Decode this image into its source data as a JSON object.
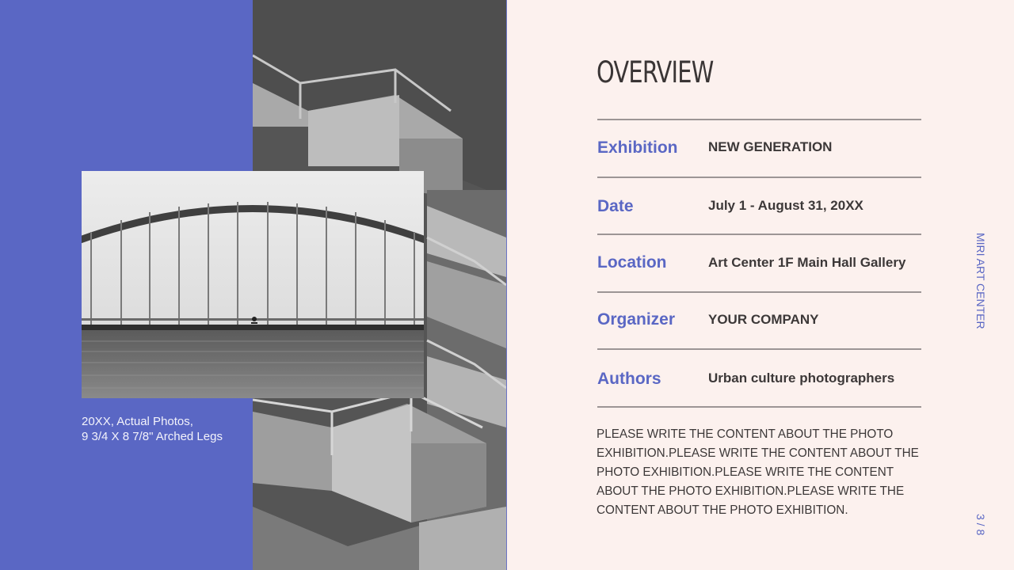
{
  "caption": {
    "line1": "20XX, Actual Photos,",
    "line2": "9 3/4 X 8 7/8\" Arched Legs"
  },
  "title": "OVERVIEW",
  "details": [
    {
      "label": "Exhibition",
      "value": "NEW GENERATION"
    },
    {
      "label": "Date",
      "value": "July 1 - August 31, 20XX"
    },
    {
      "label": "Location",
      "value": "Art Center 1F Main Hall Gallery"
    },
    {
      "label": "Organizer",
      "value": "YOUR COMPANY"
    },
    {
      "label": "Authors",
      "value": "Urban culture photographers"
    }
  ],
  "description": "PLEASE WRITE THE CONTENT ABOUT THE PHOTO EXHIBITION.PLEASE WRITE THE CONTENT ABOUT THE PHOTO EXHIBITION.PLEASE WRITE THE CONTENT ABOUT THE PHOTO EXHIBITION.PLEASE WRITE THE CONTENT ABOUT THE PHOTO EXHIBITION.",
  "side_label": "MIRI ART CENTER",
  "page_number": "3 / 8",
  "colors": {
    "accent": "#5a67c4",
    "background": "#fcf1ee",
    "text": "#3c3838"
  }
}
